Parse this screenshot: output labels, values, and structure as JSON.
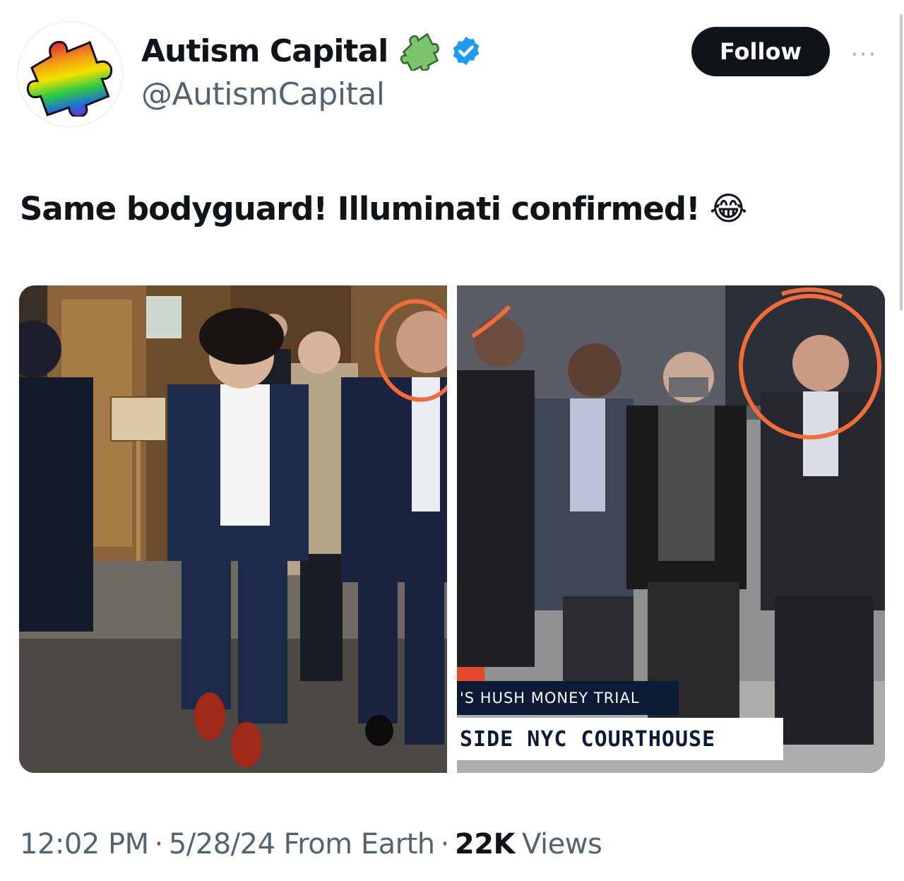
{
  "author": {
    "display_name": "Autism Capital",
    "handle": "@AutismCapital",
    "verified": true,
    "badge_icon": "puzzle-piece-emoji",
    "avatar_icon": "rainbow-puzzle-piece"
  },
  "actions": {
    "follow_label": "Follow",
    "more_label": "···"
  },
  "tweet": {
    "text": "Same bodyguard! Illuminati confirmed!",
    "emoji": "😂"
  },
  "media": {
    "left_photo": "courthouse-exit-photo",
    "right_photo": "news-broadcast-still",
    "chyron_top": "'S HUSH MONEY TRIAL",
    "chyron_bottom": "SIDE NYC COURTHOUSE",
    "annotation_color": "#f26b3a"
  },
  "meta": {
    "time": "12:02 PM",
    "date": "5/28/24",
    "source": "From Earth",
    "views_count": "22K",
    "views_label": "Views",
    "separator": "·"
  },
  "colors": {
    "text_primary": "#0f1419",
    "text_secondary": "#536471",
    "verified_blue": "#1d9bf0",
    "follow_bg": "#0f1419"
  }
}
